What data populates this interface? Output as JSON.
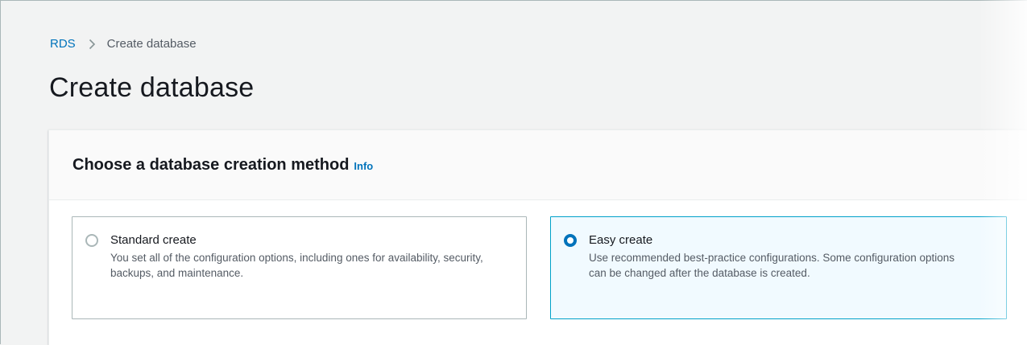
{
  "breadcrumb": {
    "root": "RDS",
    "current": "Create database"
  },
  "page": {
    "title": "Create database"
  },
  "creation_method": {
    "title": "Choose a database creation method",
    "info_label": "Info",
    "options": [
      {
        "label": "Standard create",
        "description": "You set all of the configuration options, including ones for availability, security, backups, and maintenance.",
        "selected": false
      },
      {
        "label": "Easy create",
        "description": "Use recommended best-practice configurations. Some configuration options can be changed after the database is created.",
        "selected": true
      }
    ]
  },
  "colors": {
    "link": "#0073bb",
    "selected_border": "#00a1c9",
    "selected_bg": "#f1faff",
    "page_bg": "#f2f3f3"
  },
  "icons": {
    "breadcrumb_separator": "chevron-right-icon"
  }
}
